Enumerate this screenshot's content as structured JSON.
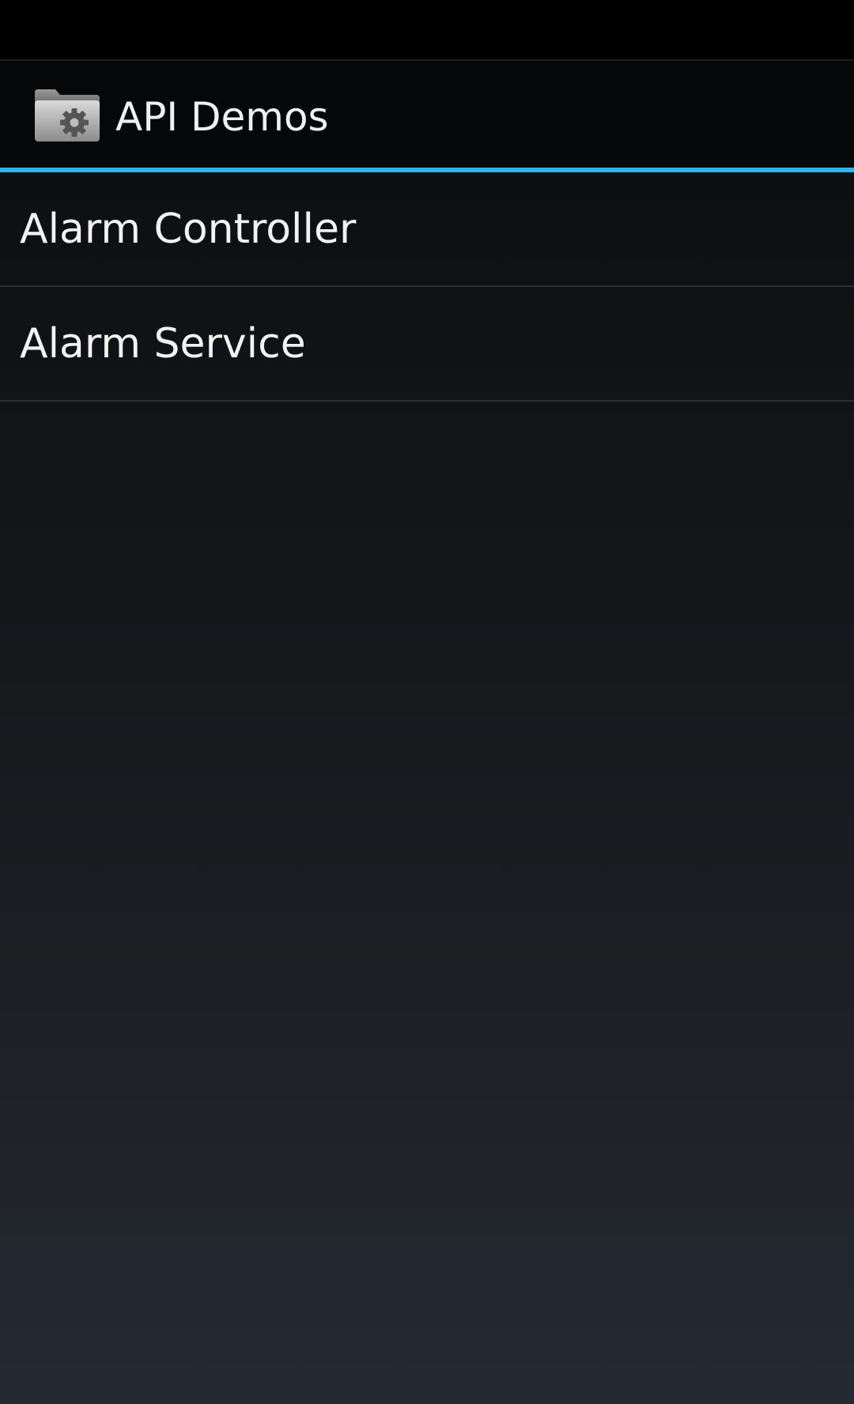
{
  "action_bar": {
    "icon": "folder-gear-icon",
    "title": "API Demos",
    "accent_color": "#33b5e5"
  },
  "list": {
    "items": [
      {
        "label": "Alarm Controller"
      },
      {
        "label": "Alarm Service"
      }
    ]
  }
}
